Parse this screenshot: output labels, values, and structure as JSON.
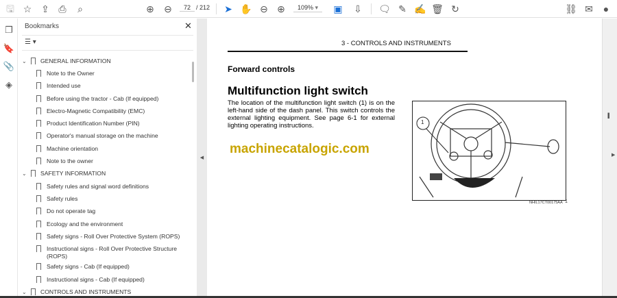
{
  "toolbar": {
    "page_current": "72",
    "page_total": "/ 212",
    "zoom": "109%"
  },
  "panel": {
    "title": "Bookmarks",
    "close": "✕",
    "options": "☰ ▾"
  },
  "bookmarks": [
    {
      "label": "GENERAL INFORMATION",
      "level": 0
    },
    {
      "label": "Note to the Owner",
      "level": 1
    },
    {
      "label": "Intended use",
      "level": 1
    },
    {
      "label": "Before using the tractor - Cab (If equipped)",
      "level": 1
    },
    {
      "label": "Electro-Magnetic Compatibility (EMC)",
      "level": 1
    },
    {
      "label": "Product Identification Number (PIN)",
      "level": 1
    },
    {
      "label": "Operator's manual storage on the machine",
      "level": 1
    },
    {
      "label": "Machine orientation",
      "level": 1
    },
    {
      "label": "Note to the owner",
      "level": 1
    },
    {
      "label": "SAFETY INFORMATION",
      "level": 0
    },
    {
      "label": "Safety rules and signal word definitions",
      "level": 1
    },
    {
      "label": "Safety rules",
      "level": 1
    },
    {
      "label": "Do not operate tag",
      "level": 1
    },
    {
      "label": "Ecology and the environment",
      "level": 1
    },
    {
      "label": "Safety signs - Roll Over Protective System (ROPS)",
      "level": 1
    },
    {
      "label": "Instructional signs - Roll Over Protective Structure (ROPS)",
      "level": 1
    },
    {
      "label": "Safety signs - Cab (If equipped)",
      "level": 1
    },
    {
      "label": "Instructional signs - Cab (If equipped)",
      "level": 1
    },
    {
      "label": "CONTROLS AND INSTRUMENTS",
      "level": 0
    }
  ],
  "document": {
    "header": "3 - CONTROLS AND INSTRUMENTS",
    "section": "Forward controls",
    "title": "Multifunction light switch",
    "paragraph": "The location of the multifunction light switch (1) is on the left-hand side of the dash panel. This switch controls the external lighting equipment. See page 6-1 for external lighting operating instructions.",
    "watermark": "machinecatalogic.com",
    "figure_callout": "1",
    "figure_caption": "NHIL17CT00175AA",
    "figure_number": "1"
  }
}
